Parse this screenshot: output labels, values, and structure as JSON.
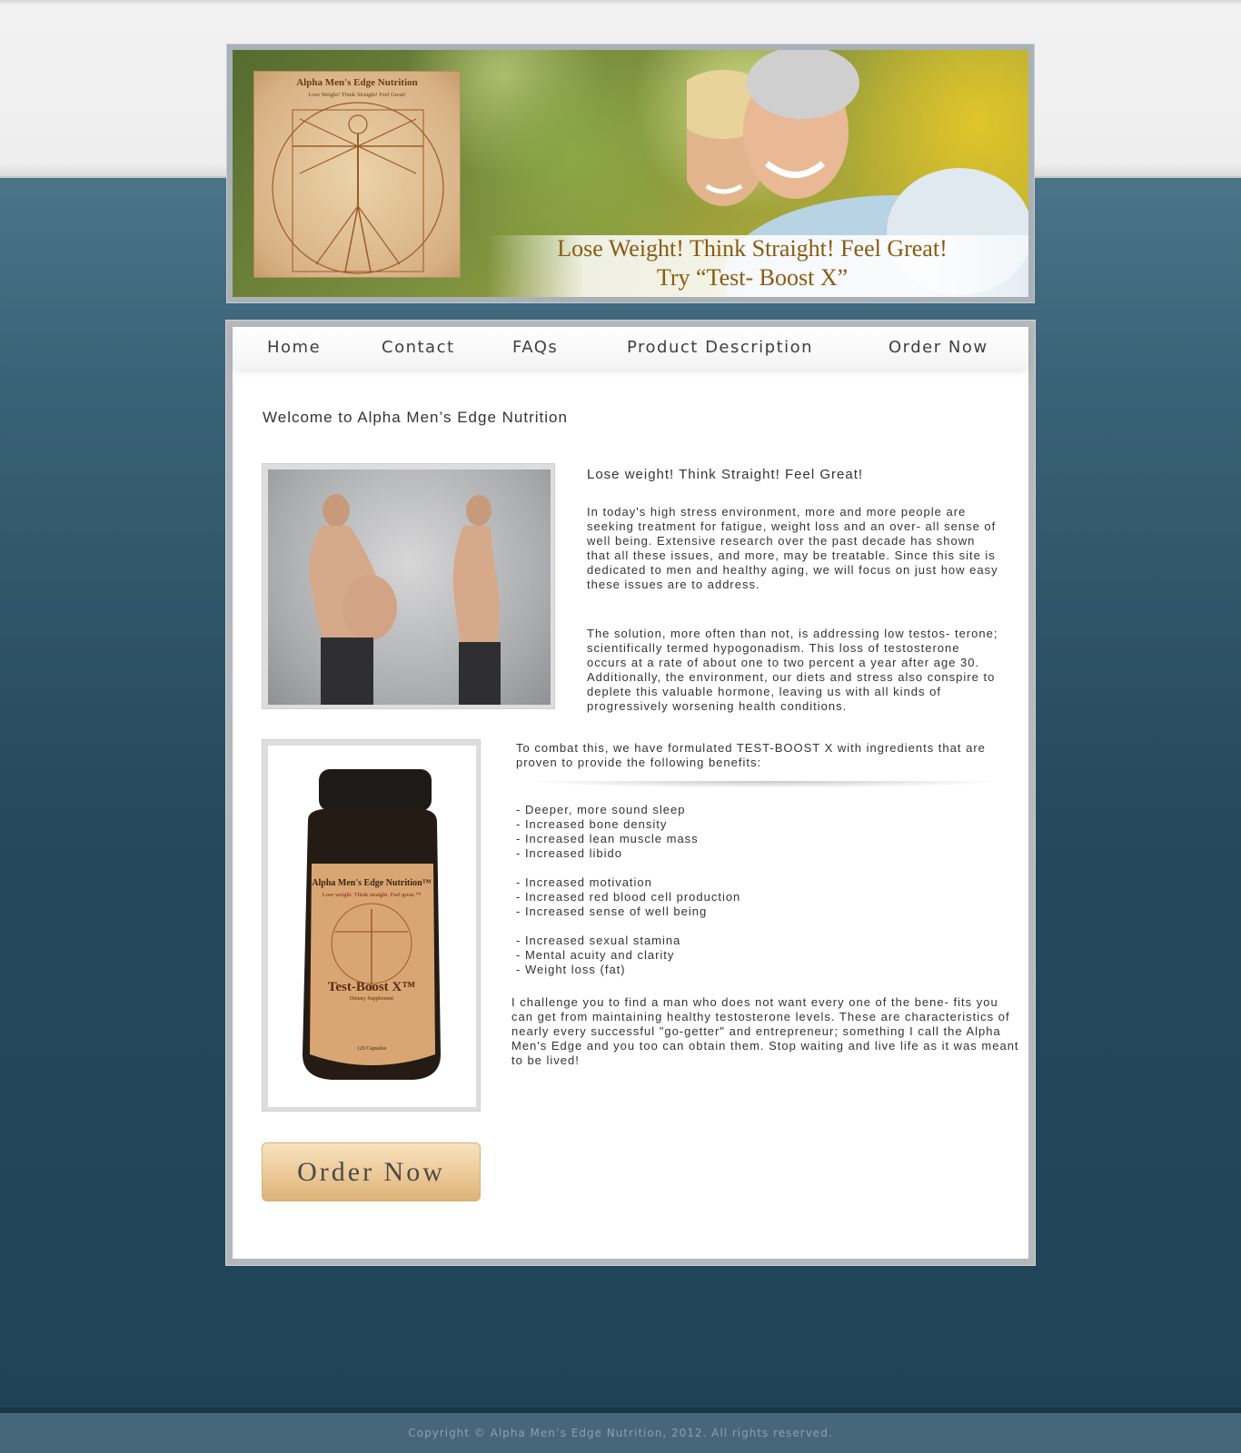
{
  "banner": {
    "logo_title": "Alpha Men's Edge Nutrition",
    "logo_subtitle": "Lose Weight! Think Straight! Feel Great!",
    "tagline_line1": "Lose Weight! Think Straight! Feel Great!",
    "tagline_line2": "Try “Test- Boost X”"
  },
  "nav": {
    "items": [
      {
        "label": "Home"
      },
      {
        "label": "Contact"
      },
      {
        "label": "FAQs"
      },
      {
        "label": "Product Description"
      },
      {
        "label": "Order Now"
      }
    ]
  },
  "main": {
    "welcome": "Welcome to Alpha Men’s Edge Nutrition",
    "subheading": "Lose weight! Think Straight! Feel Great!",
    "paragraph1": "In today's high stress environment, more and more people are seeking treatment for fatigue, weight loss and an over- all sense of well being. Extensive research over the past decade has shown that all these issues, and more, may be treatable. Since this site is dedicated to men and healthy aging, we will focus on just how easy these issues are to address.",
    "paragraph2": "The solution, more often than not, is addressing low testos- terone; scientifically termed hypogonadism. This loss of testosterone occurs at a rate of about one to two percent a year after age 30. Additionally, the environment, our diets and stress also conspire to deplete this valuable hormone, leaving us with all kinds of progressively worsening health conditions.",
    "paragraph3": "To combat this, we have formulated TEST-BOOST X with ingredients that are proven to provide the following benefits:",
    "benefits_group1": [
      "- Deeper, more sound sleep",
      "- Increased bone density",
      "- Increased lean muscle mass",
      "- Increased libido"
    ],
    "benefits_group2": [
      "- Increased motivation",
      "- Increased red blood cell production",
      "- Increased sense of well being"
    ],
    "benefits_group3": [
      "- Increased sexual stamina",
      "- Mental acuity and clarity",
      "- Weight loss (fat)"
    ],
    "paragraph4": "I challenge you to find a man who does not want every one of the bene- fits you can get from maintaining healthy testosterone levels. These are characteristics of nearly every successful \"go-getter\" and entrepreneur; something I call the Alpha Men's Edge and you too can obtain them. Stop waiting and live life as it was meant to be lived!",
    "order_button": "Order Now",
    "bottle_brand": "Alpha Men's Edge Nutrition™",
    "bottle_slogan": "Lose weight. Think straight. Feel great.™",
    "bottle_product": "Test-Boost X™",
    "bottle_type": "Dietary Supplement",
    "bottle_count": "120 Capsules"
  },
  "footer": {
    "copyright": "Copyright © Alpha Men’s Edge Nutrition, 2012. All rights reserved."
  }
}
